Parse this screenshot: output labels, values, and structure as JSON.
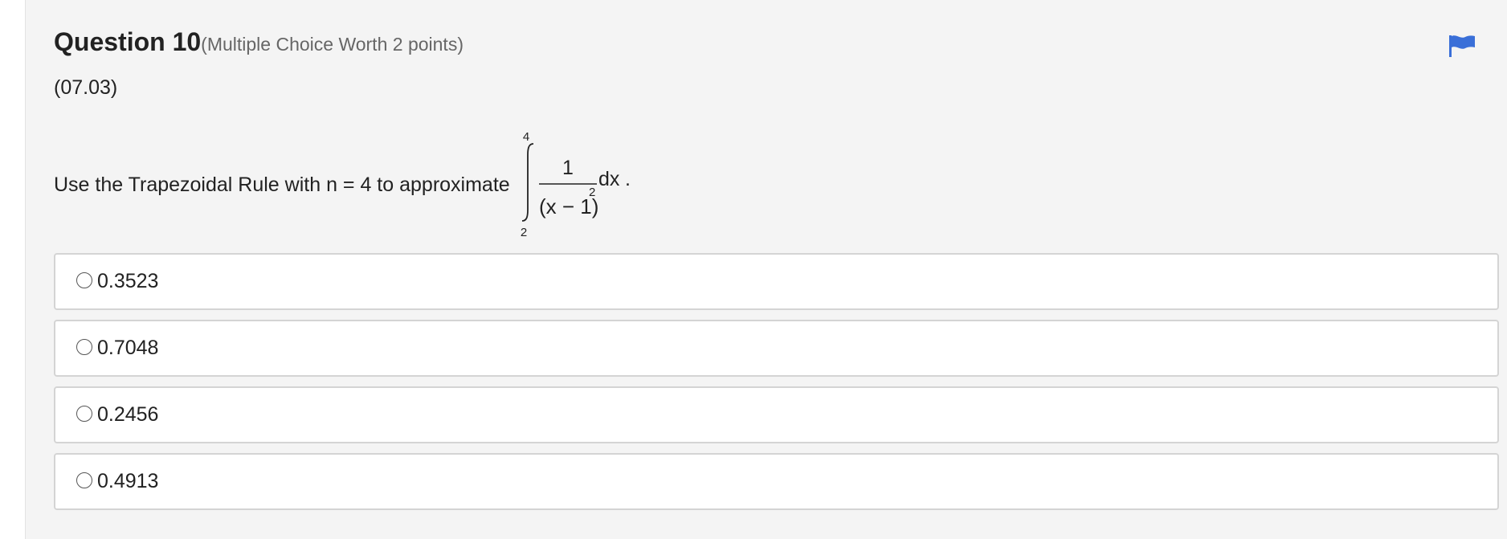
{
  "question": {
    "number_label": "Question 10",
    "meta": "(Multiple Choice Worth 2 points)",
    "standard": "(07.03)",
    "prompt": "Use the Trapezoidal Rule with n = 4 to approximate",
    "integral": {
      "upper_limit": "4",
      "lower_limit": "2",
      "numerator": "1",
      "denominator": "(x − 1)",
      "exponent": "2",
      "differential": "dx",
      "end": "."
    }
  },
  "flag": {
    "icon": "flag-icon",
    "color": "#3a6fd8"
  },
  "options": [
    {
      "label": "0.3523"
    },
    {
      "label": "0.7048"
    },
    {
      "label": "0.2456"
    },
    {
      "label": "0.4913"
    }
  ]
}
